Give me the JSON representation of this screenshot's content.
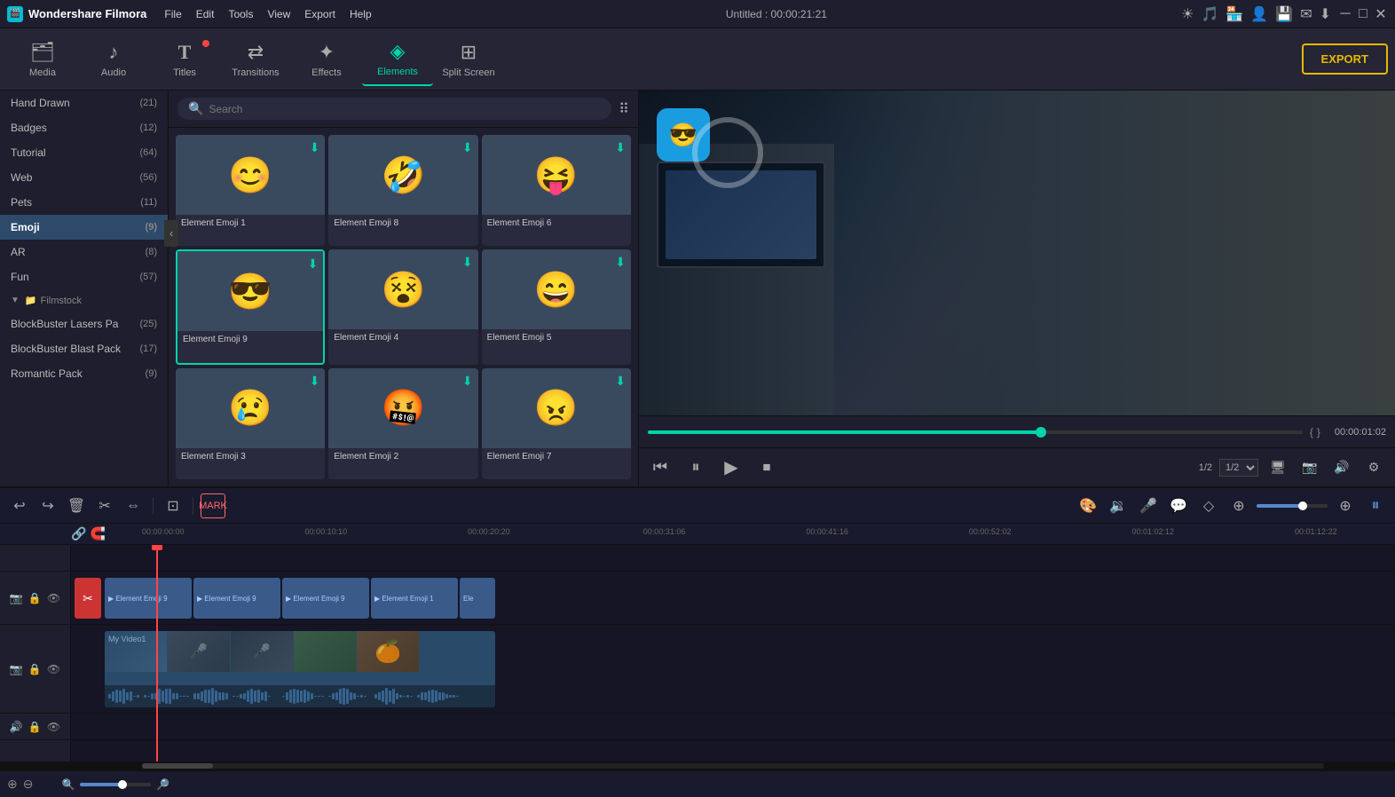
{
  "app": {
    "name": "Wondershare Filmora",
    "title": "Untitled : 00:00:21:21",
    "logo_icon": "🎬"
  },
  "menu": {
    "items": [
      "File",
      "Edit",
      "Tools",
      "View",
      "Export",
      "Help"
    ]
  },
  "window_controls": {
    "minimize": "─",
    "maximize": "□",
    "close": "✕"
  },
  "toolbar": {
    "items": [
      {
        "id": "media",
        "icon": "🗂",
        "label": "Media",
        "active": false,
        "badge": false
      },
      {
        "id": "audio",
        "icon": "🎵",
        "label": "Audio",
        "active": false,
        "badge": false
      },
      {
        "id": "titles",
        "icon": "T",
        "label": "Titles",
        "active": false,
        "badge": true
      },
      {
        "id": "transitions",
        "icon": "⇄",
        "label": "Transitions",
        "active": false,
        "badge": false
      },
      {
        "id": "effects",
        "icon": "✨",
        "label": "Effects",
        "active": false,
        "badge": false
      },
      {
        "id": "elements",
        "icon": "◈",
        "label": "Elements",
        "active": true,
        "badge": false
      },
      {
        "id": "splitscreen",
        "icon": "⊞",
        "label": "Split Screen",
        "active": false,
        "badge": false
      }
    ],
    "export_label": "EXPORT"
  },
  "left_panel": {
    "items": [
      {
        "label": "Hand Drawn",
        "count": 21
      },
      {
        "label": "Badges",
        "count": 12
      },
      {
        "label": "Tutorial",
        "count": 64
      },
      {
        "label": "Web",
        "count": 56
      },
      {
        "label": "Pets",
        "count": 11
      },
      {
        "label": "Emoji",
        "count": 9,
        "active": true
      },
      {
        "label": "AR",
        "count": 8
      },
      {
        "label": "Fun",
        "count": 57
      }
    ],
    "section": {
      "label": "Filmstock",
      "sub_items": [
        {
          "label": "BlockBuster Lasers Pa",
          "count": 25
        },
        {
          "label": "BlockBuster Blast Pack",
          "count": 17
        },
        {
          "label": "Romantic Pack",
          "count": 9
        }
      ]
    }
  },
  "search": {
    "placeholder": "Search",
    "value": ""
  },
  "elements_grid": {
    "items": [
      {
        "id": "emoji1",
        "label": "Element Emoji 1",
        "emoji": "😊",
        "selected": false,
        "has_download": true
      },
      {
        "id": "emoji8",
        "label": "Element Emoji 8",
        "emoji": "🤣",
        "selected": false,
        "has_download": true
      },
      {
        "id": "emoji6",
        "label": "Element Emoji 6",
        "emoji": "😝",
        "selected": false,
        "has_download": true
      },
      {
        "id": "emoji9",
        "label": "Element Emoji 9",
        "emoji": "😎",
        "selected": true,
        "has_download": true
      },
      {
        "id": "emoji4",
        "label": "Element Emoji 4",
        "emoji": "😵",
        "selected": false,
        "has_download": true
      },
      {
        "id": "emoji5",
        "label": "Element Emoji 5",
        "emoji": "😄",
        "selected": false,
        "has_download": true
      },
      {
        "id": "emoji3",
        "label": "Element Emoji 3",
        "emoji": "😢",
        "selected": false,
        "has_download": true
      },
      {
        "id": "emoji2",
        "label": "Element Emoji 2",
        "emoji": "🤬",
        "selected": false,
        "has_download": true
      },
      {
        "id": "emoji7",
        "label": "Element Emoji 7",
        "emoji": "😠",
        "selected": false,
        "has_download": true
      }
    ]
  },
  "preview": {
    "time_current": "00:00:01:02",
    "time_fraction": "1/2",
    "progress_percent": 60
  },
  "playback_controls": {
    "rewind": "⏮",
    "step_back": "⏪",
    "play": "▶",
    "stop": "⏹",
    "icons_right": [
      "🖥",
      "📷",
      "🔊",
      "⚙"
    ]
  },
  "edit_toolbar": {
    "icons": [
      "↩",
      "↪",
      "🗑",
      "✂",
      "⇔"
    ],
    "marker_label": "MARK"
  },
  "timeline": {
    "ruler_times": [
      {
        "label": "00:00:00:00",
        "pos_pct": 0
      },
      {
        "label": "00:00:10:10",
        "pos_pct": 13
      },
      {
        "label": "00:00:20:20",
        "pos_pct": 26
      },
      {
        "label": "00:00:31:06",
        "pos_pct": 40
      },
      {
        "label": "00:00:41:16",
        "pos_pct": 53
      },
      {
        "label": "00:00:52:02",
        "pos_pct": 66
      },
      {
        "label": "00:01:02:12",
        "pos_pct": 79
      },
      {
        "label": "00:01:12:22",
        "pos_pct": 92
      }
    ],
    "tracks": [
      {
        "type": "elements",
        "segments": [
          "Element Emoji 9",
          "Element Emoji 9",
          "Element Emoji 9",
          "Element Emoji 1",
          "Ele"
        ]
      },
      {
        "type": "video",
        "label": "My Video1"
      }
    ]
  },
  "tl_bottom": {
    "icons": [
      "⊕",
      "⊖"
    ],
    "zoom_label": "🔍"
  }
}
